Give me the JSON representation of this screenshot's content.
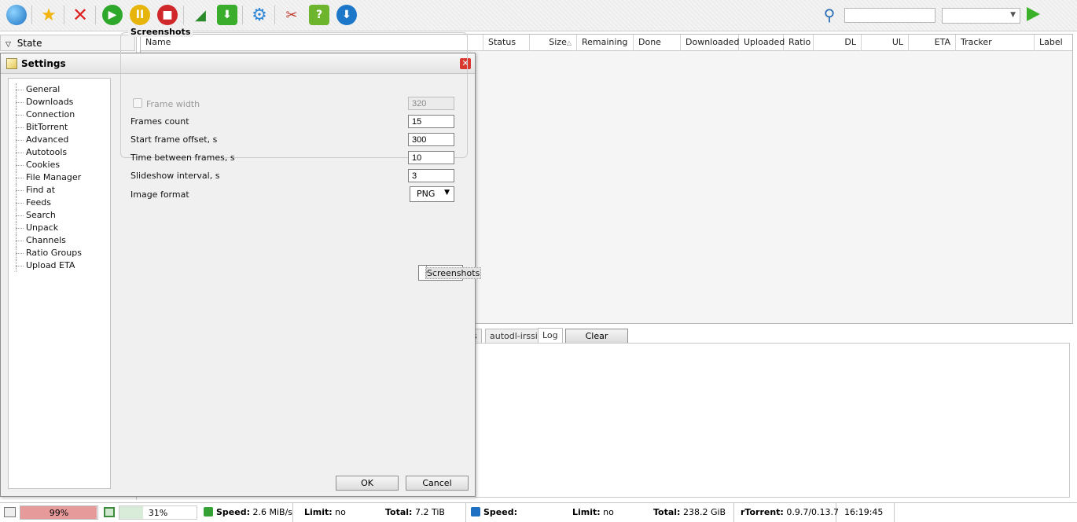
{
  "toolbar": {
    "icons": [
      "globe-icon",
      "star-icon",
      "remove-icon",
      "start-icon",
      "pause-icon",
      "stop-icon",
      "rss-icon",
      "download-icon",
      "settings-icon",
      "plugins-icon",
      "help-icon",
      "update-icon"
    ],
    "search_value": "",
    "search_engine": "",
    "colors": {
      "start": "#2ea82a",
      "pause": "#e7b40a",
      "stop": "#d0282a",
      "download": "#3aae2c",
      "help": "#6cb52c",
      "update": "#1d77c9"
    }
  },
  "sidebar": {
    "state_header": "State"
  },
  "table": {
    "columns": [
      "Name",
      "Status",
      "Size",
      "Remaining",
      "Done",
      "Downloaded",
      "Uploaded",
      "Ratio",
      "DL",
      "UL",
      "ETA",
      "Tracker",
      "Label"
    ],
    "sort_column": "Size"
  },
  "tabs": {
    "items": [
      "s",
      "autodl-irssi",
      "Log"
    ],
    "active": "Log",
    "clear_label": "Clear"
  },
  "settings": {
    "title": "Settings",
    "nav": [
      "General",
      "Downloads",
      "Connection",
      "BitTorrent",
      "Advanced",
      "Autotools",
      "Cookies",
      "File Manager",
      "Find at",
      "Feeds",
      "Search",
      "Unpack",
      "Channels",
      "Ratio Groups",
      "Screenshots",
      "Upload ETA"
    ],
    "selected": "Screenshots",
    "section_title": "Screenshots",
    "frame_width_label": "Frame width",
    "frame_width_value": "320",
    "frame_width_checked": false,
    "frames_count_label": "Frames count",
    "frames_count_value": "15",
    "start_offset_label": "Start frame offset, s",
    "start_offset_value": "300",
    "time_between_label": "Time between frames, s",
    "time_between_value": "10",
    "slideshow_label": "Slideshow interval, s",
    "slideshow_value": "3",
    "image_format_label": "Image format",
    "image_format_value": "PNG",
    "ok_label": "OK",
    "cancel_label": "Cancel"
  },
  "status": {
    "disk_meter": "99%",
    "mem_meter": "31%",
    "disk_meter_fraction": 0.99,
    "mem_meter_fraction": 0.31,
    "ul_speed_label": "Speed:",
    "ul_speed": "2.6 MiB/s",
    "ul_limit_label": "Limit:",
    "ul_limit": "no",
    "ul_total_label": "Total:",
    "ul_total": "7.2 TiB",
    "dl_speed_label": "Speed:",
    "dl_speed": "",
    "dl_limit_label": "Limit:",
    "dl_limit": "no",
    "dl_total_label": "Total:",
    "dl_total": "238.2 GiB",
    "version_label": "rTorrent:",
    "version": "0.9.7/0.13.7",
    "time": "16:19:45"
  }
}
